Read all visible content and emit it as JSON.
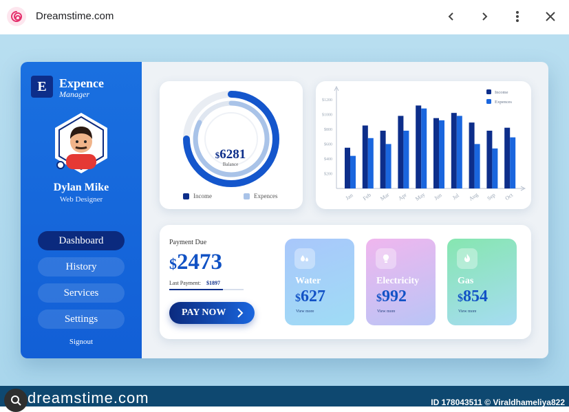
{
  "browser": {
    "site_title": "Dreamstime.com"
  },
  "app": {
    "logo_letter": "E",
    "logo_title": "Expence",
    "logo_subtitle": "Manager",
    "user": {
      "name": "Dylan Mike",
      "role": "Web Designer"
    },
    "menu": [
      {
        "label": "Dashboard",
        "active": true
      },
      {
        "label": "History",
        "active": false
      },
      {
        "label": "Services",
        "active": false
      },
      {
        "label": "Settings",
        "active": false
      }
    ],
    "signout_label": "Signout"
  },
  "balance": {
    "currency": "$",
    "amount": "6281",
    "label": "Balance",
    "legend": [
      "Income",
      "Expences"
    ]
  },
  "payment": {
    "label": "Payment Due",
    "currency": "$",
    "amount": "2473",
    "last_payment_label": "Last Payment:",
    "last_payment_value": "$1897",
    "progress_fraction": 0.72,
    "button_label": "PAY NOW"
  },
  "utilities": [
    {
      "name": "Water",
      "currency": "$",
      "amount": "627",
      "more": "View more",
      "icon": "water-drops-icon"
    },
    {
      "name": "Electricity",
      "currency": "$",
      "amount": "992",
      "more": "View more",
      "icon": "lightbulb-icon"
    },
    {
      "name": "Gas",
      "currency": "$",
      "amount": "854",
      "more": "View more",
      "icon": "flame-icon"
    }
  ],
  "colors": {
    "sidebar": "#1a70e0",
    "income": "#0d2e8a",
    "expences": "#1a66de",
    "accent": "#1152c4"
  },
  "chart_data": {
    "type": "bar",
    "categories": [
      "Jan",
      "Feb",
      "Mar",
      "Apr",
      "May",
      "Jun",
      "Jul",
      "Aug",
      "Sep",
      "Oct"
    ],
    "series": [
      {
        "name": "Income",
        "values": [
          550,
          850,
          780,
          980,
          1120,
          950,
          1020,
          890,
          780,
          820
        ]
      },
      {
        "name": "Expences",
        "values": [
          440,
          680,
          600,
          780,
          1080,
          920,
          980,
          600,
          540,
          690
        ]
      }
    ],
    "ytick_labels": [
      "$200",
      "$400",
      "$600",
      "$800",
      "$1000",
      "$1200"
    ],
    "ylim": [
      0,
      1300
    ],
    "legend_position": "top-right",
    "grid": false
  },
  "watermark": {
    "brand": "dreamstime.com",
    "id_text": "ID 178043511 © Viraldhameliya822"
  }
}
